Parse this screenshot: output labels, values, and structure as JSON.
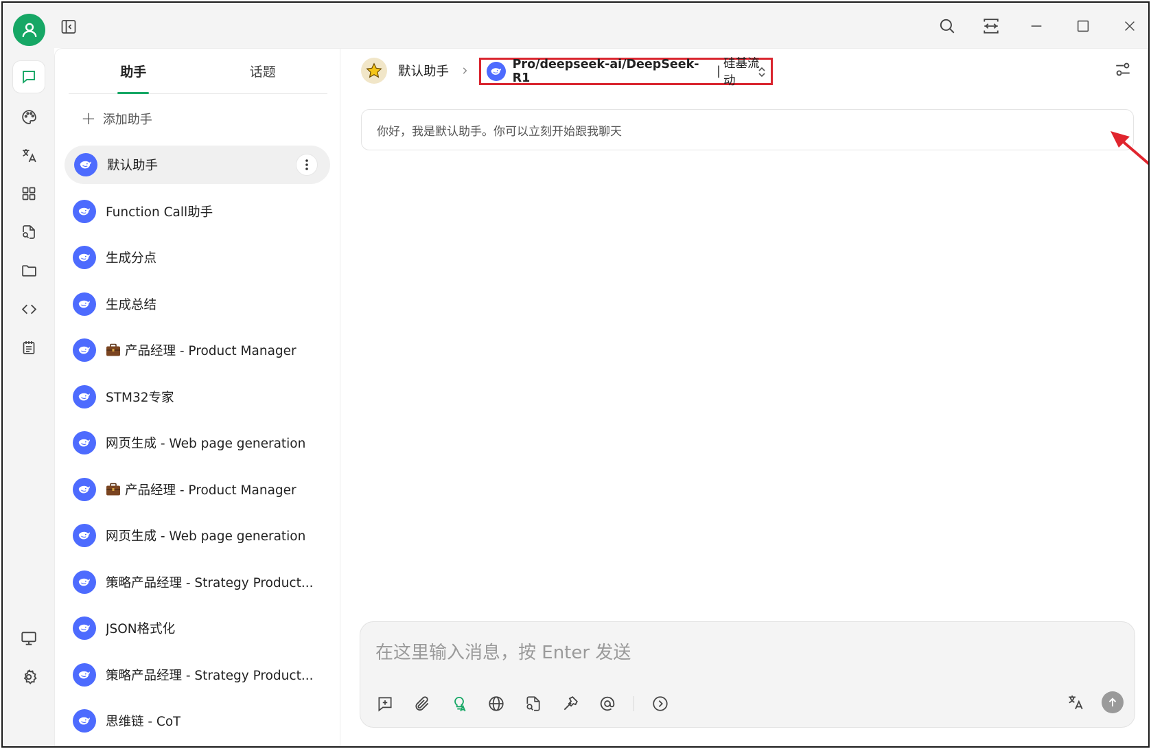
{
  "window": {
    "controls": [
      "search-icon",
      "fullscreen-icon",
      "minimize-icon",
      "maximize-icon",
      "close-icon"
    ]
  },
  "colors": {
    "accent": "#16a765",
    "model_avatar": "#4d6bfe",
    "highlight_box": "#d9252f",
    "arrow": "#e0252e"
  },
  "rail": {
    "items": [
      "chat-icon",
      "palette-icon",
      "translate-icon",
      "apps-icon",
      "file-search-icon",
      "folder-icon",
      "code-icon",
      "notes-icon"
    ],
    "bottom": [
      "monitor-icon",
      "settings-gear-icon"
    ]
  },
  "sidebar": {
    "tabs": [
      {
        "label": "助手",
        "active": true
      },
      {
        "label": "话题",
        "active": false
      }
    ],
    "add_label": "添加助手",
    "assistants": [
      {
        "label": "默认助手",
        "active": true
      },
      {
        "label": "Function Call助手"
      },
      {
        "label": "生成分点"
      },
      {
        "label": "生成总结"
      },
      {
        "label": "产品经理 - Product Manager",
        "emoji": "briefcase"
      },
      {
        "label": "STM32专家"
      },
      {
        "label": "网页生成 - Web page generation"
      },
      {
        "label": "产品经理 - Product Manager",
        "emoji": "briefcase"
      },
      {
        "label": "网页生成 - Web page generation"
      },
      {
        "label": "策略产品经理 - Strategy Product..."
      },
      {
        "label": "JSON格式化"
      },
      {
        "label": "策略产品经理 - Strategy Product..."
      },
      {
        "label": "思维链 - CoT"
      }
    ]
  },
  "main": {
    "breadcrumb": {
      "assistant": "默认助手",
      "model": "Pro/deepseek-ai/DeepSeek-R1",
      "separator": "|",
      "provider": "硅基流动"
    },
    "greeting": "你好，我是默认助手。你可以立刻开始跟我聊天",
    "composer": {
      "placeholder": "在这里输入消息，按 Enter 发送",
      "tools": [
        "new-topic-icon",
        "attachment-icon",
        "prompt-suggest-icon",
        "web-search-icon",
        "knowledge-base-icon",
        "tools-hammer-icon",
        "mention-icon",
        "expand-icon"
      ]
    }
  }
}
